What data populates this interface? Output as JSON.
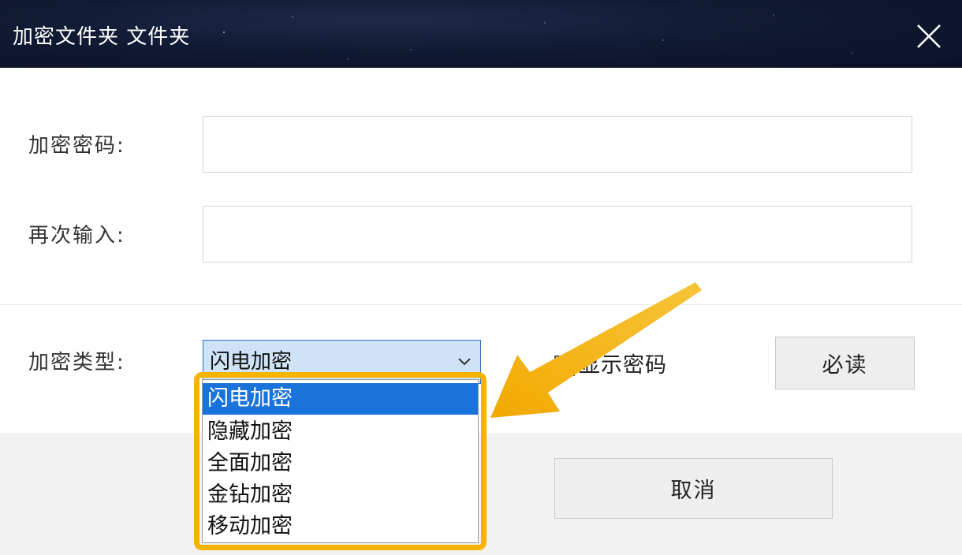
{
  "window": {
    "title": "加密文件夹 文件夹",
    "close_icon": "close-icon"
  },
  "form": {
    "password_label": "加密密码:",
    "password_value": "",
    "confirm_label": "再次输入:",
    "confirm_value": "",
    "type_label": "加密类型:",
    "type_selected": "闪电加密",
    "show_password_label": "显示密码",
    "show_password_checked": false
  },
  "buttons": {
    "must_read": "必读",
    "cancel": "取消"
  },
  "dropdown": {
    "options": [
      "闪电加密",
      "隐藏加密",
      "全面加密",
      "金钻加密",
      "移动加密"
    ],
    "selected_index": 0
  },
  "colors": {
    "titlebar": "#111a33",
    "selected_option": "#1a73d9",
    "highlight_border": "#f6b400",
    "select_background": "#cfe3f7"
  }
}
